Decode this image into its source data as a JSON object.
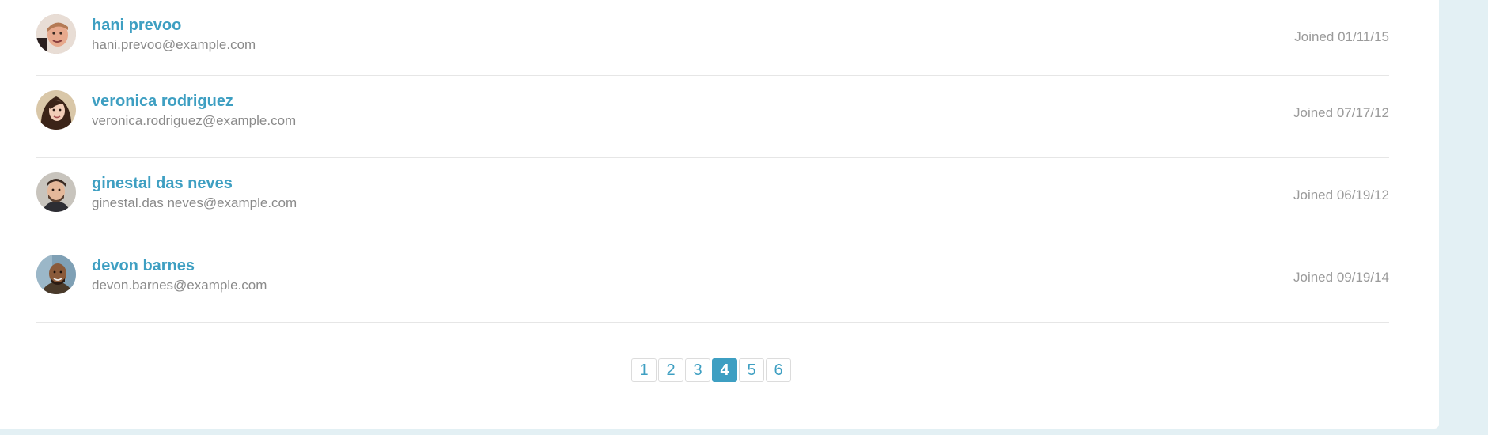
{
  "users": [
    {
      "name": "hani prevoo",
      "email": "hani.prevoo@example.com",
      "joined": "Joined 01/11/15",
      "avatar": "avatar-hani"
    },
    {
      "name": "veronica rodriguez",
      "email": "veronica.rodriguez@example.com",
      "joined": "Joined 07/17/12",
      "avatar": "avatar-veronica"
    },
    {
      "name": "ginestal das neves",
      "email": "ginestal.das neves@example.com",
      "joined": "Joined 06/19/12",
      "avatar": "avatar-ginestal"
    },
    {
      "name": "devon barnes",
      "email": "devon.barnes@example.com",
      "joined": "Joined 09/19/14",
      "avatar": "avatar-devon"
    }
  ],
  "pagination": {
    "pages": [
      "1",
      "2",
      "3",
      "4",
      "5",
      "6"
    ],
    "current": "4"
  },
  "colors": {
    "accent": "#3e9fc2",
    "background": "#e3f0f4",
    "card": "#ffffff",
    "muted_text": "#8a8a8a",
    "divider": "#e6e6e6"
  }
}
